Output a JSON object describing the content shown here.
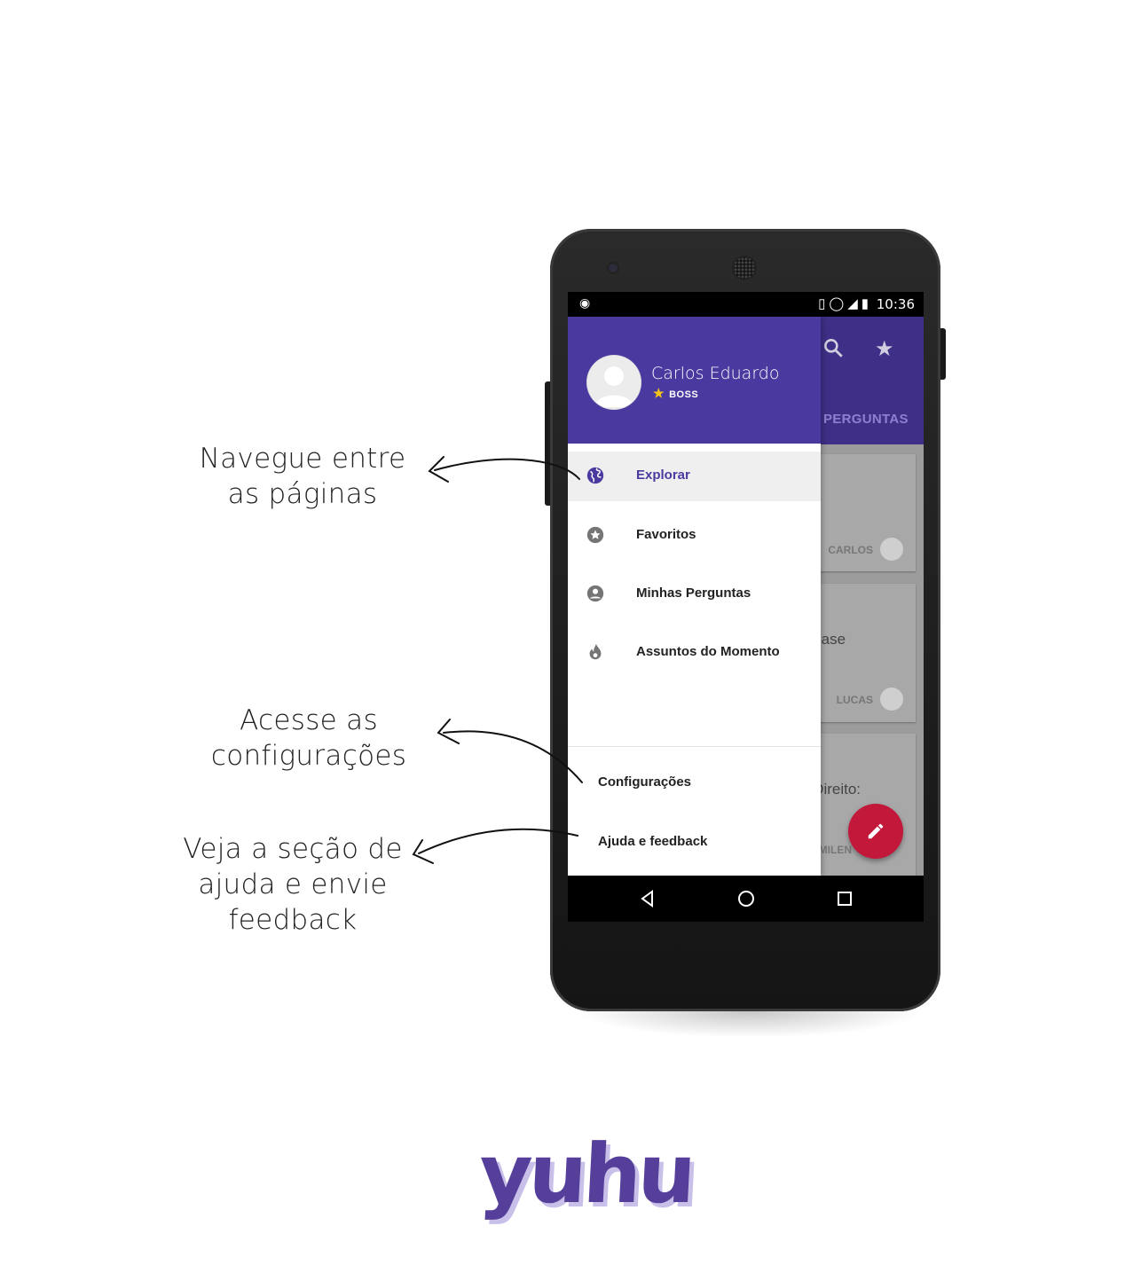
{
  "callouts": {
    "nav": [
      "Navegue entre",
      "as páginas"
    ],
    "config": [
      "Acesse as",
      "configurações"
    ],
    "help": [
      "Veja a seção de",
      "ajuda e envie",
      "feedback"
    ]
  },
  "statusbar": {
    "time": "10:36"
  },
  "background_app": {
    "tab_label": "PERGUNTAS",
    "cards": [
      {
        "author": "CARLOS",
        "snippet": ""
      },
      {
        "author": "LUCAS",
        "snippet": "a base"
      },
      {
        "author": "MILEN",
        "snippet": "u Direito:"
      }
    ]
  },
  "drawer": {
    "user": {
      "name": "Carlos Eduardo",
      "badge": "BOSS"
    },
    "items": [
      {
        "label": "Explorar",
        "icon": "globe-icon",
        "active": true
      },
      {
        "label": "Favoritos",
        "icon": "star-circle-icon",
        "active": false
      },
      {
        "label": "Minhas Perguntas",
        "icon": "account-circle-icon",
        "active": false
      },
      {
        "label": "Assuntos do Momento",
        "icon": "flame-icon",
        "active": false
      }
    ],
    "footer": [
      {
        "label": "Configurações"
      },
      {
        "label": "Ajuda e feedback"
      }
    ]
  },
  "colors": {
    "primary": "#4a3aa0",
    "primary_dark": "#3f2f86",
    "fab": "#c2183a",
    "logo": "#553f9a"
  },
  "logo": {
    "text": "yuhu"
  }
}
